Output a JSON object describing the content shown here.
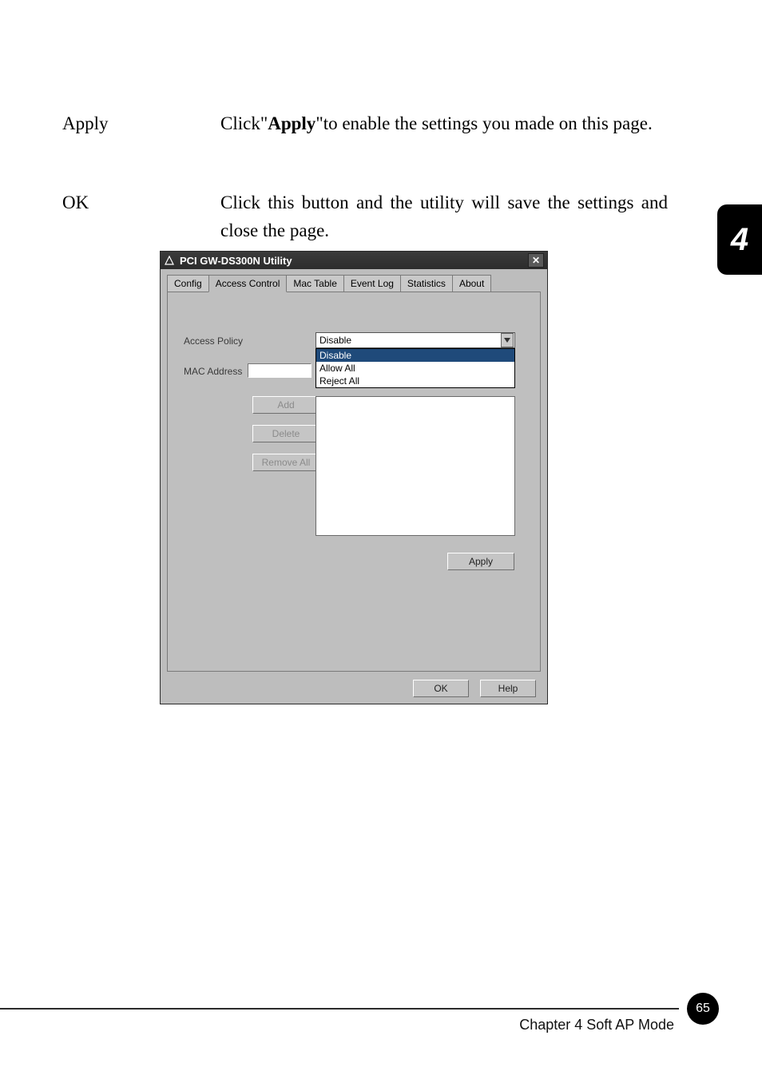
{
  "doc": {
    "rows": [
      {
        "term": "Apply",
        "desc_pre": "Click\"",
        "desc_bold": "Apply",
        "desc_post": "\"to enable the settings you made on this page."
      },
      {
        "term": "OK",
        "desc_pre": "Click this button and the utility will save the settings and close the page.",
        "desc_bold": "",
        "desc_post": ""
      }
    ],
    "side_chapter": "4",
    "footer": "Chapter 4 Soft AP Mode",
    "page_number": "65"
  },
  "win": {
    "title": "PCI GW-DS300N Utility",
    "close_glyph": "✕",
    "tabs": [
      "Config",
      "Access Control",
      "Mac Table",
      "Event Log",
      "Statistics",
      "About"
    ],
    "active_tab_index": 1,
    "labels": {
      "access_policy": "Access Policy",
      "mac_address": "MAC Address"
    },
    "dropdown": {
      "selected": "Disable",
      "options": [
        "Disable",
        "Allow All",
        "Reject All"
      ],
      "selected_index": 0
    },
    "buttons": {
      "add": "Add",
      "delete": "Delete",
      "remove_all": "Remove All",
      "apply": "Apply",
      "ok": "OK",
      "help": "Help"
    },
    "mac_input_value": ""
  }
}
